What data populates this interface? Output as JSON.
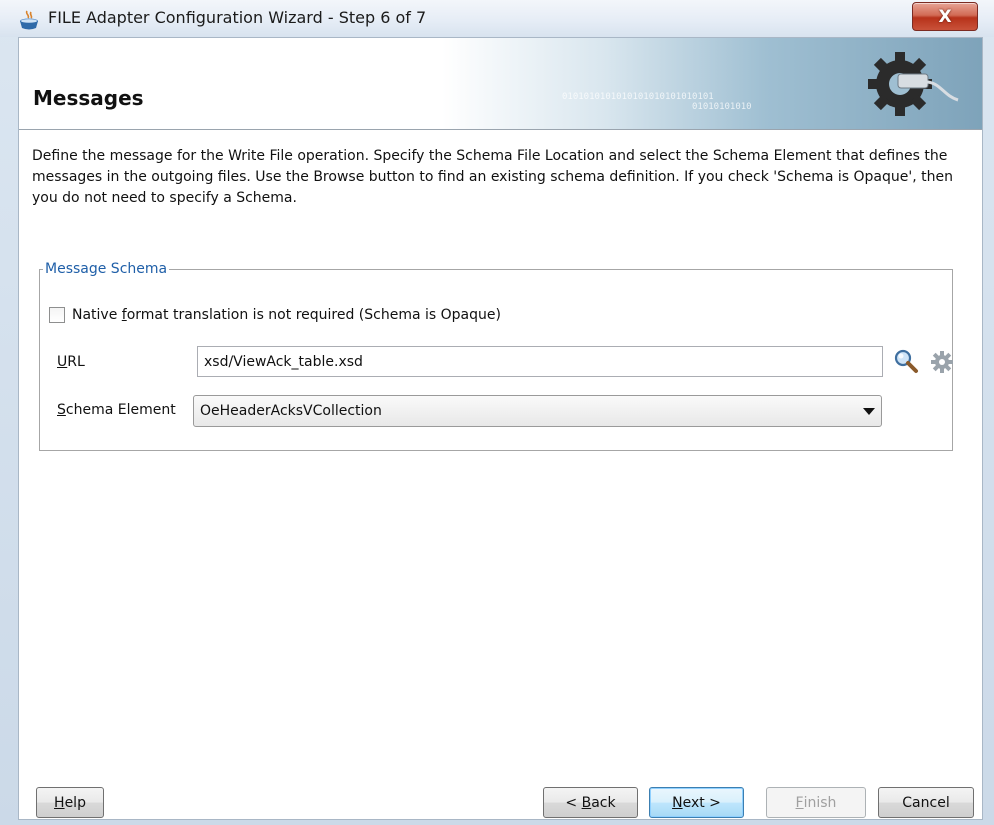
{
  "window": {
    "title": "FILE Adapter Configuration Wizard - Step 6 of 7",
    "close_glyph": "X"
  },
  "header": {
    "title": "Messages",
    "binary_line1": "0101010101010101010101010101",
    "binary_line2": "01010101010"
  },
  "description": "Define the message for the Write File operation.  Specify the Schema File Location and select the Schema Element that defines the messages in the outgoing files. Use the Browse button to find an existing schema definition. If you check 'Schema is Opaque', then you do not need to specify a Schema.",
  "message_schema": {
    "legend": "Message Schema",
    "opaque_checkbox": {
      "label_pre": "Native ",
      "label_mnemonic": "f",
      "label_post": "ormat translation is not required (Schema is Opaque)",
      "checked": false
    },
    "url": {
      "label_mnemonic": "U",
      "label_rest": "RL",
      "value": "xsd/ViewAck_table.xsd"
    },
    "schema_element": {
      "label_mnemonic": "S",
      "label_rest": "chema Element",
      "selected": "OeHeaderAcksVCollection"
    }
  },
  "buttons": {
    "help": {
      "mnemonic": "H",
      "rest": "elp"
    },
    "back": {
      "pre": "< ",
      "mnemonic": "B",
      "rest": "ack"
    },
    "next": {
      "mnemonic": "N",
      "rest": "ext >"
    },
    "finish": {
      "mnemonic": "F",
      "rest": "inish"
    },
    "cancel": {
      "label": "Cancel"
    }
  },
  "icons": {
    "title_icon": "coffee-cup-icon",
    "browse": "search-icon",
    "generate": "gear-icon"
  }
}
